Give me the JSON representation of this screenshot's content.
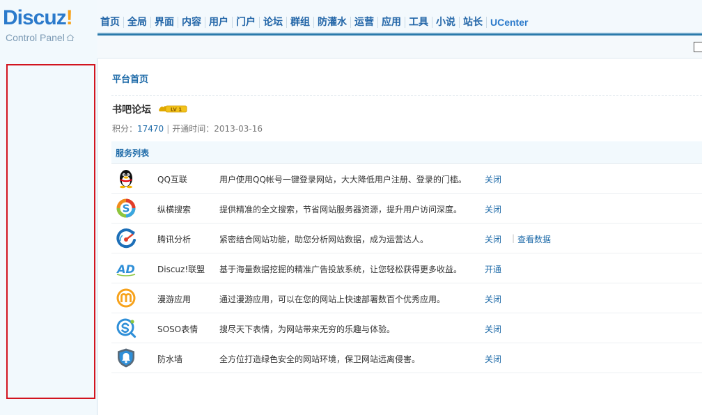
{
  "logo": {
    "brand_main": "Discuz",
    "brand_mark": "!",
    "subtitle": "Control Panel"
  },
  "nav": {
    "items": [
      "首页",
      "全局",
      "界面",
      "内容",
      "用户",
      "门户",
      "论坛",
      "群组",
      "防灌水",
      "运营",
      "应用",
      "工具",
      "小说",
      "站长",
      "UCenter"
    ]
  },
  "content": {
    "page_title": "平台首页",
    "site": {
      "name": "书吧论坛",
      "level_badge": "LV 1",
      "score_label": "积分：",
      "score": "17470",
      "divider": "|",
      "open_label": "开通时间：",
      "open_date": "2013-03-16"
    },
    "services_title": "服务列表",
    "services": [
      {
        "icon": "qq-penguin-icon",
        "name": "QQ互联",
        "desc": "用户使用QQ帐号一键登录网站，大大降低用户注册、登录的门槛。",
        "action": "关闭",
        "extra": ""
      },
      {
        "icon": "search-s-icon",
        "name": "纵横搜索",
        "desc": "提供精准的全文搜索，节省网站服务器资源，提升用户访问深度。",
        "action": "关闭",
        "extra": ""
      },
      {
        "icon": "analytics-gauge-icon",
        "name": "腾讯分析",
        "desc": "紧密结合网站功能，助您分析网站数据，成为运营达人。",
        "action": "关闭",
        "extra": "查看数据"
      },
      {
        "icon": "ad-icon",
        "name": "Discuz!联盟",
        "desc": "基于海量数据挖掘的精准广告投放系统，让您轻松获得更多收益。",
        "action": "开通",
        "extra": ""
      },
      {
        "icon": "manyou-m-icon",
        "name": "漫游应用",
        "desc": "通过漫游应用，可以在您的网站上快速部署数百个优秀应用。",
        "action": "关闭",
        "extra": ""
      },
      {
        "icon": "soso-emoji-icon",
        "name": "SOSO表情",
        "desc": "搜尽天下表情，为网站带来无穷的乐趣与体验。",
        "action": "关闭",
        "extra": ""
      },
      {
        "icon": "firewall-shield-icon",
        "name": "防水墙",
        "desc": "全方位打造绿色安全的网站环境，保卫网站远离侵害。",
        "action": "关闭",
        "extra": ""
      }
    ]
  },
  "colors": {
    "nav_text": "#2366a8",
    "link": "#1d6aa8",
    "logo_blue": "#2b7acb",
    "logo_orange": "#f7a21b",
    "sidebar_highlight": "#d2141f"
  }
}
